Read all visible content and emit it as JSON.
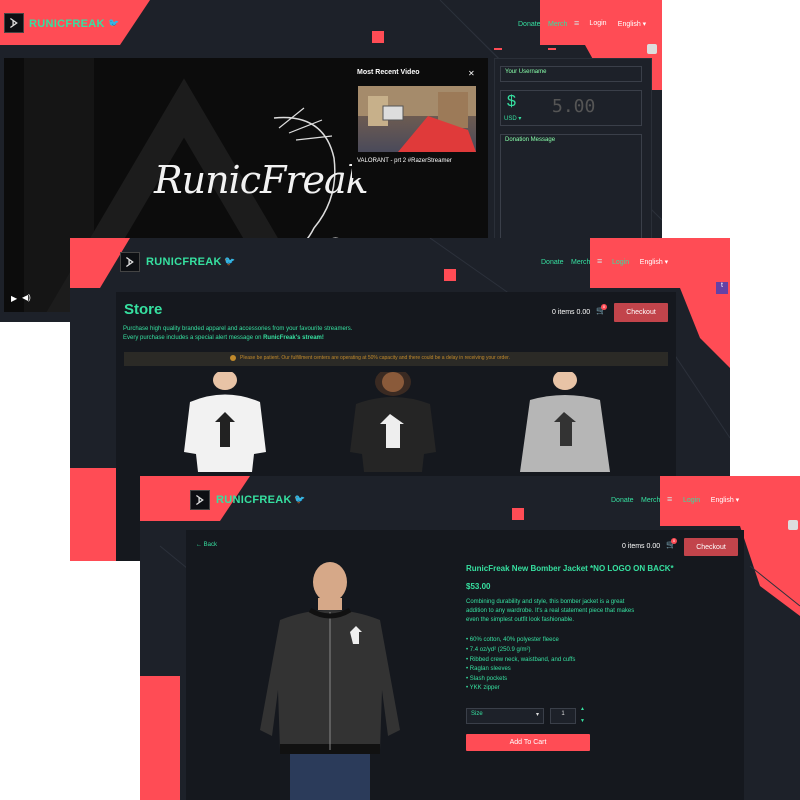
{
  "colors": {
    "accent": "#ff4c55",
    "brand_green": "#36e0a0",
    "bg": "#1d2129",
    "panel": "#15181e"
  },
  "screen1": {
    "brand": "RUNICFREAK",
    "nav": {
      "donate": "Donate",
      "merch": "Merch",
      "login": "Login",
      "language": "English ▾"
    },
    "video_logo_text": "RunicFreak",
    "recent_video": {
      "heading": "Most Recent Video",
      "close": "✕",
      "caption": "VALORANT - prt 2 #RazerStreamer"
    },
    "donation": {
      "username_placeholder": "Your Username",
      "currency_symbol": "$",
      "amount_placeholder": "5.00",
      "currency": "USD ▾",
      "message_placeholder": "Donation Message"
    },
    "controls": {
      "play": "▶",
      "volume": "🔊"
    }
  },
  "screen2": {
    "brand": "RUNICFREAK",
    "nav": {
      "donate": "Donate",
      "merch": "Merch",
      "login": "Login",
      "language": "English ▾"
    },
    "store": {
      "title": "Store",
      "desc_line1": "Purchase high quality branded apparel and accessories from your favourite streamers.",
      "desc_line2_prefix": "Every purchase includes a special alert message on ",
      "desc_line2_bold": "RunicFreak's stream!",
      "items_count": "0 items 0.00",
      "cart_badge": "0",
      "checkout": "Checkout",
      "notice": "Please be patient. Our fulfillment centers are operating at 50% capacity and there could be a delay in receiving your order."
    }
  },
  "screen3": {
    "brand": "RUNICFREAK",
    "nav": {
      "donate": "Donate",
      "merch": "Merch",
      "login": "Login",
      "language": "English ▾"
    },
    "back": "Back",
    "items_count": "0 items 0.00",
    "cart_badge": "0",
    "checkout": "Checkout",
    "product": {
      "title": "RunicFreak New Bomber Jacket *NO LOGO ON BACK*",
      "price": "$53.00",
      "desc_line1": "Combining durability and style, this bomber jacket is a great",
      "desc_line2": "addition to any wardrobe. It's a real statement piece that makes",
      "desc_line3": "even the simplest outfit look fashionable.",
      "bullets": [
        "• 60% cotton, 40% polyester fleece",
        "• 7.4 oz/yd² (250.9 g/m²)",
        "• Ribbed crew neck, waistband, and cuffs",
        "• Raglan sleeves",
        "• Slash pockets",
        "• YKK zipper"
      ],
      "size_label": "Size",
      "quantity": "1",
      "add_to_cart": "Add To Cart"
    }
  }
}
